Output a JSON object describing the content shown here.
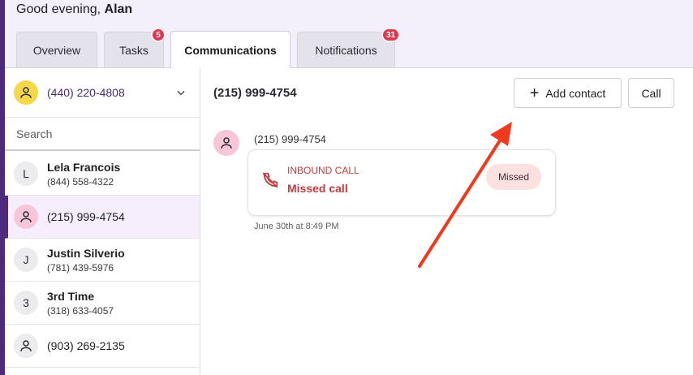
{
  "greeting": {
    "prefix": "Good evening,",
    "name": "Alan"
  },
  "tabs": [
    {
      "label": "Overview",
      "badge": ""
    },
    {
      "label": "Tasks",
      "badge": "5"
    },
    {
      "label": "Communications",
      "badge": ""
    },
    {
      "label": "Notifications",
      "badge": "31"
    }
  ],
  "sidebar": {
    "line_number": "(440) 220-4808",
    "search_placeholder": "Search",
    "contacts": [
      {
        "initial": "L",
        "name": "Lela Francois",
        "phone": "(844) 558-4322"
      },
      {
        "initial": "",
        "name": "(215) 999-4754",
        "phone": ""
      },
      {
        "initial": "J",
        "name": "Justin Silverio",
        "phone": "(781) 439-5976"
      },
      {
        "initial": "3",
        "name": "3rd Time",
        "phone": "(318) 633-4057"
      },
      {
        "initial": "",
        "name": "(903) 269-2135",
        "phone": ""
      }
    ]
  },
  "main": {
    "title": "(215) 999-4754",
    "add_contact_label": "Add contact",
    "call_label": "Call",
    "message": {
      "from": "(215) 999-4754",
      "type": "INBOUND CALL",
      "status": "Missed call",
      "pill": "Missed",
      "time": "June 30th at 8:49 PM"
    }
  },
  "colors": {
    "accent": "#4d2a7c",
    "badge": "#e0384c",
    "missed": "#c53b3b",
    "arrow": "#f03a1e"
  }
}
